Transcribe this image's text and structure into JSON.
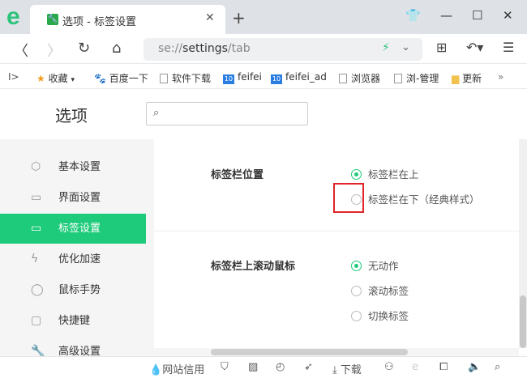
{
  "tab": {
    "title": "选项 - 标签设置"
  },
  "nav": {
    "url_scheme": "se://",
    "url_host": "settings",
    "url_path": "/tab"
  },
  "bookmarks": [
    {
      "label": "收藏",
      "icon": "star-icon"
    },
    {
      "label": "百度一下",
      "icon": "baidu-icon"
    },
    {
      "label": "软件下载",
      "icon": "doc-icon"
    },
    {
      "label": "feifei",
      "icon": "ten-icon"
    },
    {
      "label": "feifei_ad",
      "icon": "ten-icon"
    },
    {
      "label": "浏览器",
      "icon": "doc-icon"
    },
    {
      "label": "浏-管理",
      "icon": "doc-icon"
    },
    {
      "label": "更新",
      "icon": "folder-icon"
    }
  ],
  "page": {
    "title": "选项",
    "search_placeholder": ""
  },
  "sidebar": [
    {
      "label": "基本设置"
    },
    {
      "label": "界面设置"
    },
    {
      "label": "标签设置"
    },
    {
      "label": "优化加速"
    },
    {
      "label": "鼠标手势"
    },
    {
      "label": "快捷键"
    },
    {
      "label": "高级设置"
    }
  ],
  "settings": {
    "tab_position": {
      "label": "标签栏位置",
      "options": [
        "标签栏在上",
        "标签栏在下（经典样式）"
      ],
      "selected": 0
    },
    "scroll": {
      "label": "标签栏上滚动鼠标",
      "options": [
        "无动作",
        "滚动标签",
        "切换标签"
      ],
      "selected": 0
    }
  },
  "status": {
    "site_trust": "网站信用",
    "download": "下载"
  },
  "colors": {
    "accent": "#1dcb7a",
    "highlight": "#e0262a"
  }
}
